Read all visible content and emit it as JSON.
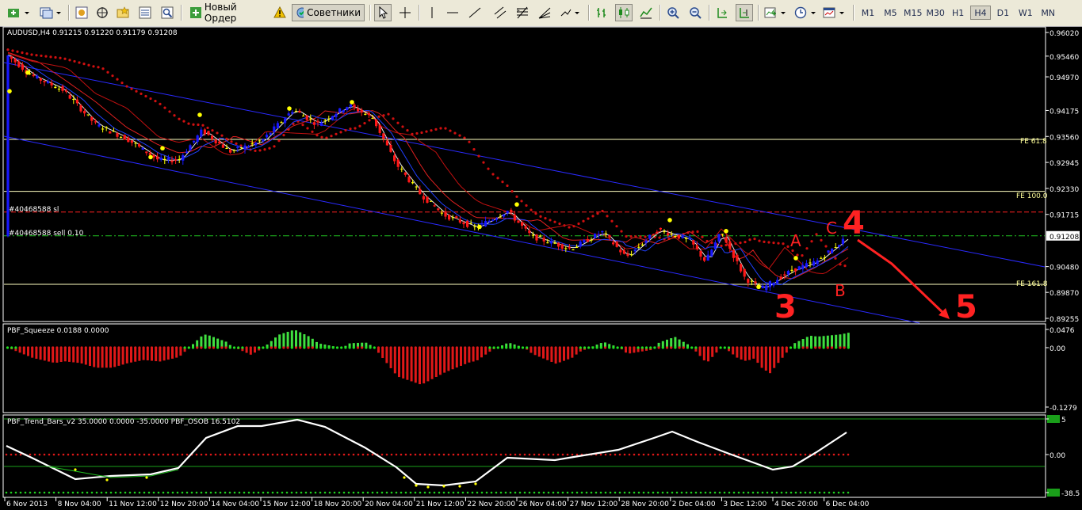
{
  "toolbar": {
    "new_order_label": "Новый Ордер",
    "advisors_label": "Советники",
    "icons": [
      "new-chart-icon",
      "profiles-icon",
      "market-watch-icon",
      "navigator-icon",
      "favorites-icon",
      "data-window-icon",
      "strategy-tester-icon",
      "new-order-icon",
      "expert-advisors-icon",
      "cursor-icon",
      "crosshair-icon",
      "trendline-icon",
      "fibo-icon",
      "text-label-icon",
      "arrows-icon",
      "bar-chart-icon",
      "candle-chart-icon",
      "line-chart-icon",
      "zoom-in-icon",
      "zoom-out-icon",
      "autoscroll-icon",
      "chart-shift-icon",
      "indicators-icon",
      "periods-icon",
      "templates-icon"
    ],
    "timeframes": [
      "M1",
      "M5",
      "M15",
      "M30",
      "H1",
      "H4",
      "D1",
      "W1",
      "MN"
    ],
    "active_timeframe": "H4"
  },
  "main_chart": {
    "header": "AUDUSD,H4  0.91215 0.91220 0.91179 0.91208",
    "price_labels": [
      "0.96020",
      "0.95460",
      "0.94970",
      "0.94175",
      "0.93560",
      "0.92945",
      "0.92330",
      "0.91715",
      "0.91208",
      "0.90480",
      "0.89870",
      "0.89255"
    ],
    "current_price": "0.91208",
    "levels": {
      "fe618": "FE 61.8",
      "fe100": "FE 100.0",
      "fe1618": "FE 161.8"
    },
    "order_sl": "#40468588 sl",
    "order_sell": "#40468588 sell 0.10",
    "wave_labels": [
      "3",
      "4",
      "5"
    ],
    "point_labels": [
      "A",
      "B",
      "C"
    ],
    "colors": {
      "bull": "#1010ff",
      "bear": "#ff1010",
      "doji": "#ffff00",
      "grid": "#1a1a1a",
      "wave": "#ff2222",
      "level": "#ffff99"
    }
  },
  "squeeze": {
    "header": "PBF_Squeeze 0.0188 0.0000",
    "labels": [
      "0.0476",
      "0.00",
      "-0.1279"
    ]
  },
  "trend_bars": {
    "header": "PBF_Trend_Bars_v2 35.0000 0.0000 -35.0000  PBF_OSOB 16.5102",
    "labels": [
      "5",
      "0.00",
      "-38.5"
    ]
  },
  "time_axis": [
    "6 Nov 2013",
    "8 Nov 04:00",
    "11 Nov 12:00",
    "12 Nov 20:00",
    "14 Nov 04:00",
    "15 Nov 12:00",
    "18 Nov 20:00",
    "20 Nov 04:00",
    "21 Nov 12:00",
    "22 Nov 20:00",
    "26 Nov 04:00",
    "27 Nov 12:00",
    "28 Nov 20:00",
    "2 Dec 04:00",
    "3 Dec 12:00",
    "4 Dec 20:00",
    "6 Dec 04:00"
  ]
}
